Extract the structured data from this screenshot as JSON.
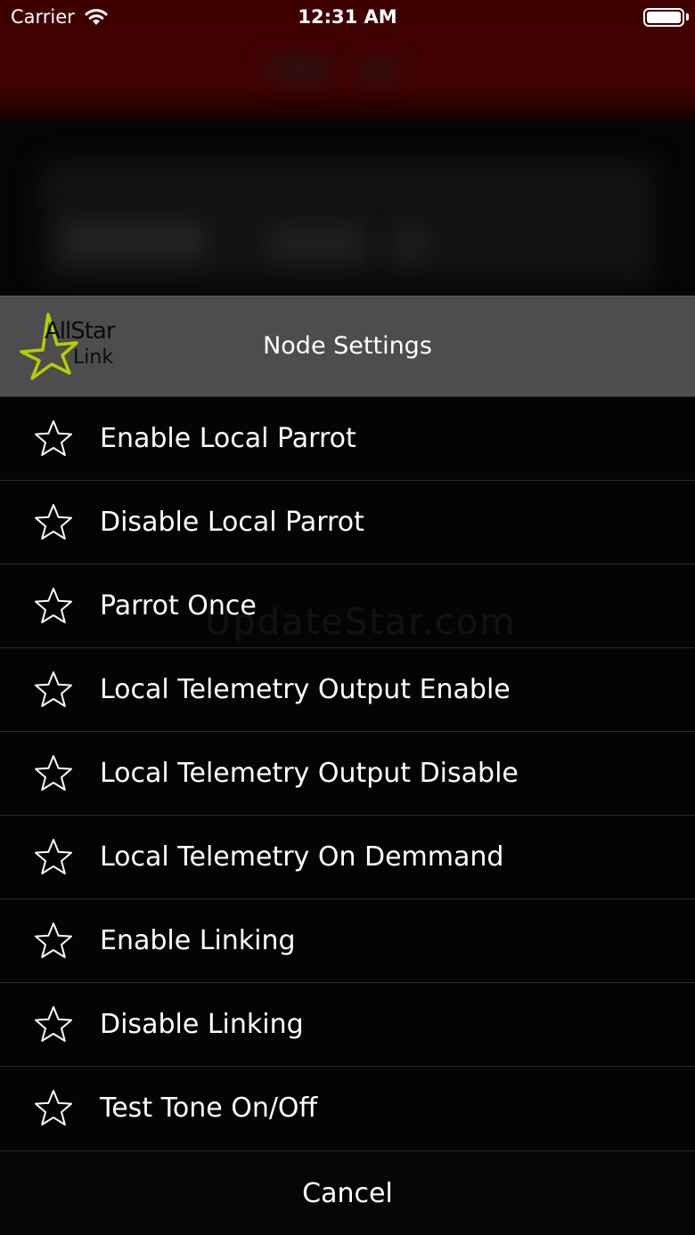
{
  "status_bar": {
    "carrier": "Carrier",
    "time": "12:31 AM"
  },
  "sheet": {
    "logo": {
      "line1": "AllStar",
      "line2": "Link",
      "accent": "#c4d600"
    },
    "title": "Node Settings",
    "items": [
      {
        "label": "Enable Local Parrot",
        "icon": "star-outline-icon"
      },
      {
        "label": "Disable Local Parrot",
        "icon": "star-outline-icon"
      },
      {
        "label": "Parrot Once",
        "icon": "star-outline-icon"
      },
      {
        "label": "Local Telemetry Output Enable",
        "icon": "star-outline-icon"
      },
      {
        "label": "Local Telemetry Output Disable",
        "icon": "star-outline-icon"
      },
      {
        "label": "Local Telemetry On Demmand",
        "icon": "star-outline-icon"
      },
      {
        "label": "Enable Linking",
        "icon": "star-outline-icon"
      },
      {
        "label": "Disable Linking",
        "icon": "star-outline-icon"
      },
      {
        "label": "Test Tone On/Off",
        "icon": "star-outline-icon"
      }
    ],
    "cancel_label": "Cancel"
  },
  "watermark": "UpdateStar.com",
  "colors": {
    "nav_bar": "#420202",
    "header": "#4d4d4d",
    "background": "#000000"
  }
}
